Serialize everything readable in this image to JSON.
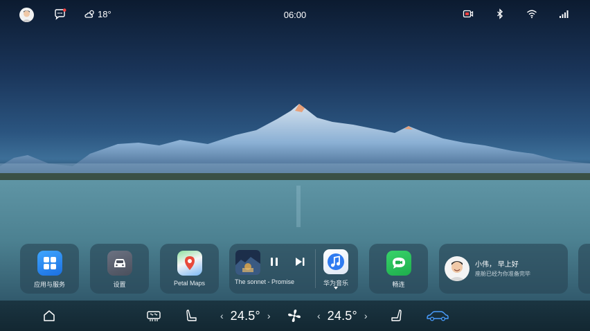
{
  "status_bar": {
    "temperature": "18°",
    "time": "06:00",
    "icons": [
      "avatar",
      "message-icon",
      "weather-icon",
      "dashcam-icon",
      "bluetooth-icon",
      "wifi-icon",
      "signal-icon"
    ],
    "notification_dot_color": "#f04040"
  },
  "dock": {
    "apps": [
      {
        "label": "应用与服务",
        "icon": "apps-grid-icon",
        "color": "#2f8ff5"
      },
      {
        "label": "设置",
        "icon": "car-settings-icon",
        "color": "#5a6070"
      },
      {
        "label": "Petal Maps",
        "icon": "map-pin-icon",
        "color": "#e84a3b"
      }
    ],
    "music": {
      "song": "The sonnet - Promise",
      "app_label": "华为音乐",
      "icons": [
        "pause-icon",
        "next-track-icon",
        "music-note-icon"
      ]
    },
    "chat_app": {
      "label": "畅连",
      "icon": "video-call-icon",
      "color": "#25c25a"
    },
    "greeting": {
      "title": "小伟， 早上好",
      "subtitle": "座舱已经为你准备完毕"
    }
  },
  "control_bar": {
    "left_temp": "24.5°",
    "right_temp": "24.5°",
    "chevron_left": "‹",
    "chevron_right": "›",
    "icons": [
      "home-icon",
      "defrost-icon",
      "seat-left-icon",
      "fan-icon",
      "seat-right-icon",
      "car-icon"
    ],
    "accent_color": "#4a9dff"
  }
}
